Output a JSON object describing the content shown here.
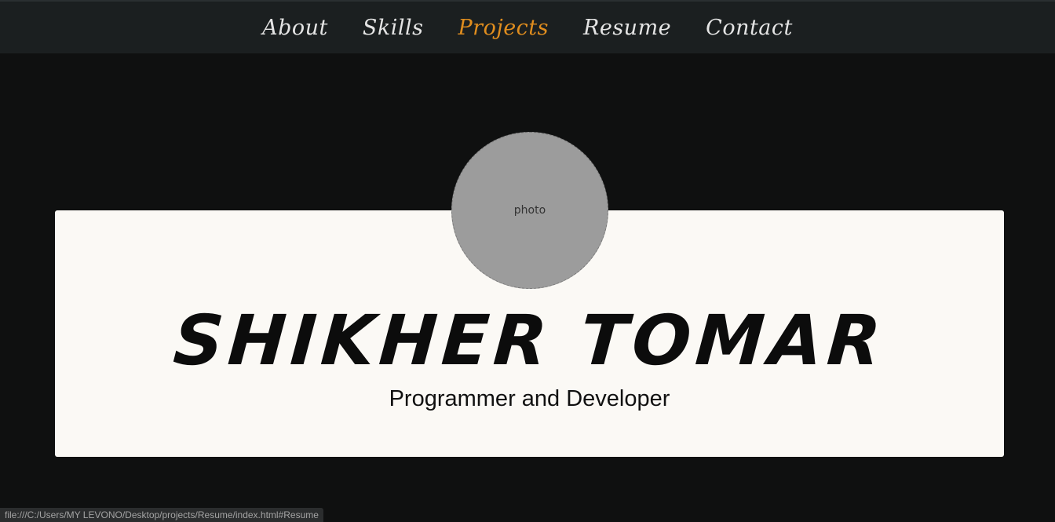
{
  "nav": {
    "items": [
      {
        "label": "About",
        "active": false
      },
      {
        "label": "Skills",
        "active": false
      },
      {
        "label": "Projects",
        "active": true
      },
      {
        "label": "Resume",
        "active": false
      },
      {
        "label": "Contact",
        "active": false
      }
    ],
    "active_color": "#e08d1e"
  },
  "hero": {
    "name": "SHIKHER TOMAR",
    "subtitle": "Programmer and Developer",
    "avatar_label": "photo"
  },
  "status": {
    "url": "file:///C:/Users/MY LEVONO/Desktop/projects/Resume/index.html#Resume"
  }
}
